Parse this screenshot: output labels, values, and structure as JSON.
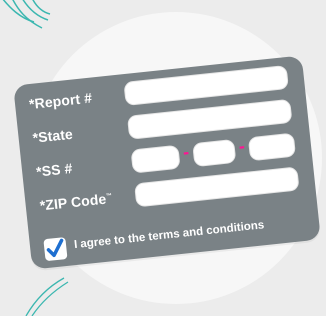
{
  "form": {
    "report_label": "*Report #",
    "state_label": "*State",
    "ssn_label": "*SS #",
    "zip_label": "*ZIP Code",
    "zip_tm": "™",
    "ssn_separator": "-",
    "terms_text": "I agree to the terms and conditions",
    "terms_checked": true
  },
  "colors": {
    "card": "#7a8286",
    "accent_pink": "#ff1493",
    "check_blue": "#1e6fd0",
    "deco_teal": "#3bb7b0"
  },
  "icons": [
    "checkmark-icon",
    "teal-sparkle-decoration",
    "teal-swoosh-decoration"
  ]
}
